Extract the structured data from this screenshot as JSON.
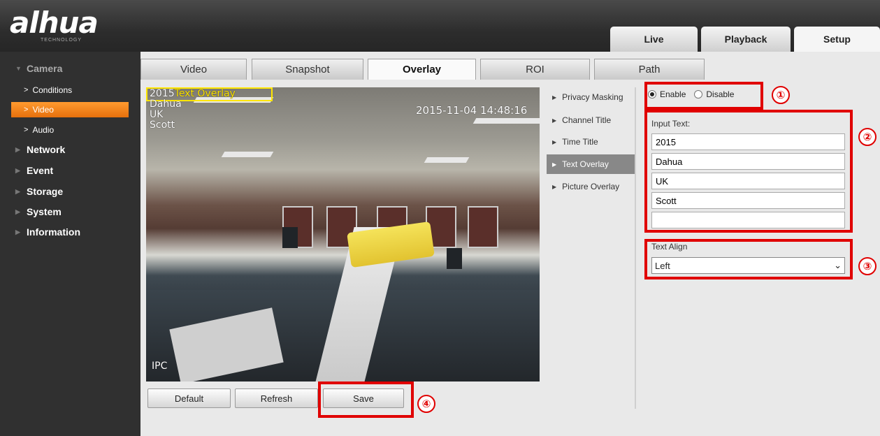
{
  "brand": {
    "logo": "alhua",
    "tagline": "TECHNOLOGY"
  },
  "top_tabs": [
    {
      "label": "Live"
    },
    {
      "label": "Playback"
    },
    {
      "label": "Setup",
      "active": true
    }
  ],
  "sidebar": {
    "categories": [
      {
        "label": "Camera",
        "expanded": true
      },
      {
        "label": "Network"
      },
      {
        "label": "Event"
      },
      {
        "label": "Storage"
      },
      {
        "label": "System"
      },
      {
        "label": "Information"
      }
    ],
    "camera_items": [
      {
        "label": "Conditions"
      },
      {
        "label": "Video",
        "active": true
      },
      {
        "label": "Audio"
      }
    ]
  },
  "sub_tabs": [
    {
      "label": "Video"
    },
    {
      "label": "Snapshot"
    },
    {
      "label": "Overlay",
      "active": true
    },
    {
      "label": "ROI"
    },
    {
      "label": "Path"
    }
  ],
  "video": {
    "overlay_box_text": "Text Overlay",
    "overlay_lines": [
      "2015",
      "Dahua",
      "UK",
      "Scott"
    ],
    "timestamp": "2015-11-04 14:48:16",
    "channel": "IPC"
  },
  "buttons": {
    "default": "Default",
    "refresh": "Refresh",
    "save": "Save"
  },
  "overlay_menu": [
    {
      "label": "Privacy Masking"
    },
    {
      "label": "Channel Title"
    },
    {
      "label": "Time Title"
    },
    {
      "label": "Text Overlay",
      "active": true
    },
    {
      "label": "Picture Overlay"
    }
  ],
  "settings": {
    "enable_label": "Enable",
    "disable_label": "Disable",
    "enabled": true,
    "input_text_label": "Input Text:",
    "inputs": [
      "2015",
      "Dahua",
      "UK",
      "Scott",
      ""
    ],
    "text_align_label": "Text Align",
    "text_align_value": "Left"
  },
  "annotations": [
    "①",
    "②",
    "③",
    "④"
  ],
  "colors": {
    "accent": "#f28a1e",
    "annotation": "#e00000",
    "osd_box": "#ffe600",
    "sidebar_bg": "#303030"
  }
}
